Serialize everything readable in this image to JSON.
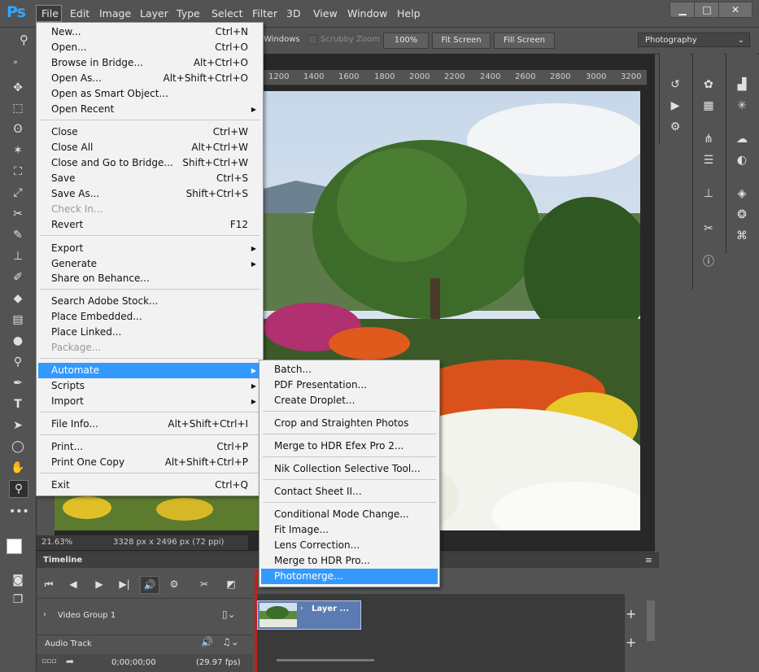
{
  "app": {
    "logo": "Ps"
  },
  "menubar": {
    "items": [
      "File",
      "Edit",
      "Image",
      "Layer",
      "Type",
      "Select",
      "Filter",
      "3D",
      "View",
      "Window",
      "Help"
    ]
  },
  "window_controls": {
    "minimize": "▁",
    "maximize": "□",
    "close": "✕"
  },
  "options_bar": {
    "windows_label": "Windows",
    "scrubby_zoom": "Scrubby Zoom",
    "zoom_value": "100%",
    "fit_screen": "Fit Screen",
    "fill_screen": "Fill Screen",
    "workspace": "Photography"
  },
  "ruler": {
    "ticks": [
      "1200",
      "1400",
      "1600",
      "1800",
      "2000",
      "2200",
      "2400",
      "2600",
      "2800",
      "3000",
      "3200"
    ]
  },
  "status": {
    "zoom": "21.63%",
    "size": "3328 px x 2496 px (72 ppi)"
  },
  "file_menu": [
    {
      "label": "New...",
      "shortcut": "Ctrl+N"
    },
    {
      "label": "Open...",
      "shortcut": "Ctrl+O"
    },
    {
      "label": "Browse in Bridge...",
      "shortcut": "Alt+Ctrl+O"
    },
    {
      "label": "Open As...",
      "shortcut": "Alt+Shift+Ctrl+O"
    },
    {
      "label": "Open as Smart Object...",
      "shortcut": ""
    },
    {
      "label": "Open Recent",
      "shortcut": "",
      "submenu": true
    },
    {
      "label": "Close",
      "shortcut": "Ctrl+W"
    },
    {
      "label": "Close All",
      "shortcut": "Alt+Ctrl+W"
    },
    {
      "label": "Close and Go to Bridge...",
      "shortcut": "Shift+Ctrl+W"
    },
    {
      "label": "Save",
      "shortcut": "Ctrl+S"
    },
    {
      "label": "Save As...",
      "shortcut": "Shift+Ctrl+S"
    },
    {
      "label": "Check In...",
      "shortcut": "",
      "disabled": true
    },
    {
      "label": "Revert",
      "shortcut": "F12"
    },
    {
      "label": "Export",
      "shortcut": "",
      "submenu": true
    },
    {
      "label": "Generate",
      "shortcut": "",
      "submenu": true
    },
    {
      "label": "Share on Behance...",
      "shortcut": ""
    },
    {
      "label": "Search Adobe Stock...",
      "shortcut": ""
    },
    {
      "label": "Place Embedded...",
      "shortcut": ""
    },
    {
      "label": "Place Linked...",
      "shortcut": ""
    },
    {
      "label": "Package...",
      "shortcut": "",
      "disabled": true
    },
    {
      "label": "Automate",
      "shortcut": "",
      "submenu": true,
      "highlighted": true
    },
    {
      "label": "Scripts",
      "shortcut": "",
      "submenu": true
    },
    {
      "label": "Import",
      "shortcut": "",
      "submenu": true
    },
    {
      "label": "File Info...",
      "shortcut": "Alt+Shift+Ctrl+I"
    },
    {
      "label": "Print...",
      "shortcut": "Ctrl+P"
    },
    {
      "label": "Print One Copy",
      "shortcut": "Alt+Shift+Ctrl+P"
    },
    {
      "label": "Exit",
      "shortcut": "Ctrl+Q"
    }
  ],
  "automate_menu": [
    {
      "label": "Batch..."
    },
    {
      "label": "PDF Presentation..."
    },
    {
      "label": "Create Droplet..."
    },
    {
      "label": "Crop and Straighten Photos"
    },
    {
      "label": "Merge to HDR Efex Pro 2..."
    },
    {
      "label": "Nik Collection Selective Tool..."
    },
    {
      "label": "Contact Sheet II..."
    },
    {
      "label": "Conditional Mode Change..."
    },
    {
      "label": "Fit Image..."
    },
    {
      "label": "Lens Correction..."
    },
    {
      "label": "Merge to HDR Pro..."
    },
    {
      "label": "Photomerge...",
      "highlighted": true
    }
  ],
  "timeline": {
    "title": "Timeline",
    "video_group": "Video Group 1",
    "audio_track": "Audio Track",
    "timecode": "0;00;00;00",
    "fps": "(29.97 fps)",
    "clip_label": "Layer ..."
  },
  "colors": {
    "accent": "#3399ff",
    "ps_blue": "#31a8ff",
    "clip": "#5b7bb2"
  }
}
